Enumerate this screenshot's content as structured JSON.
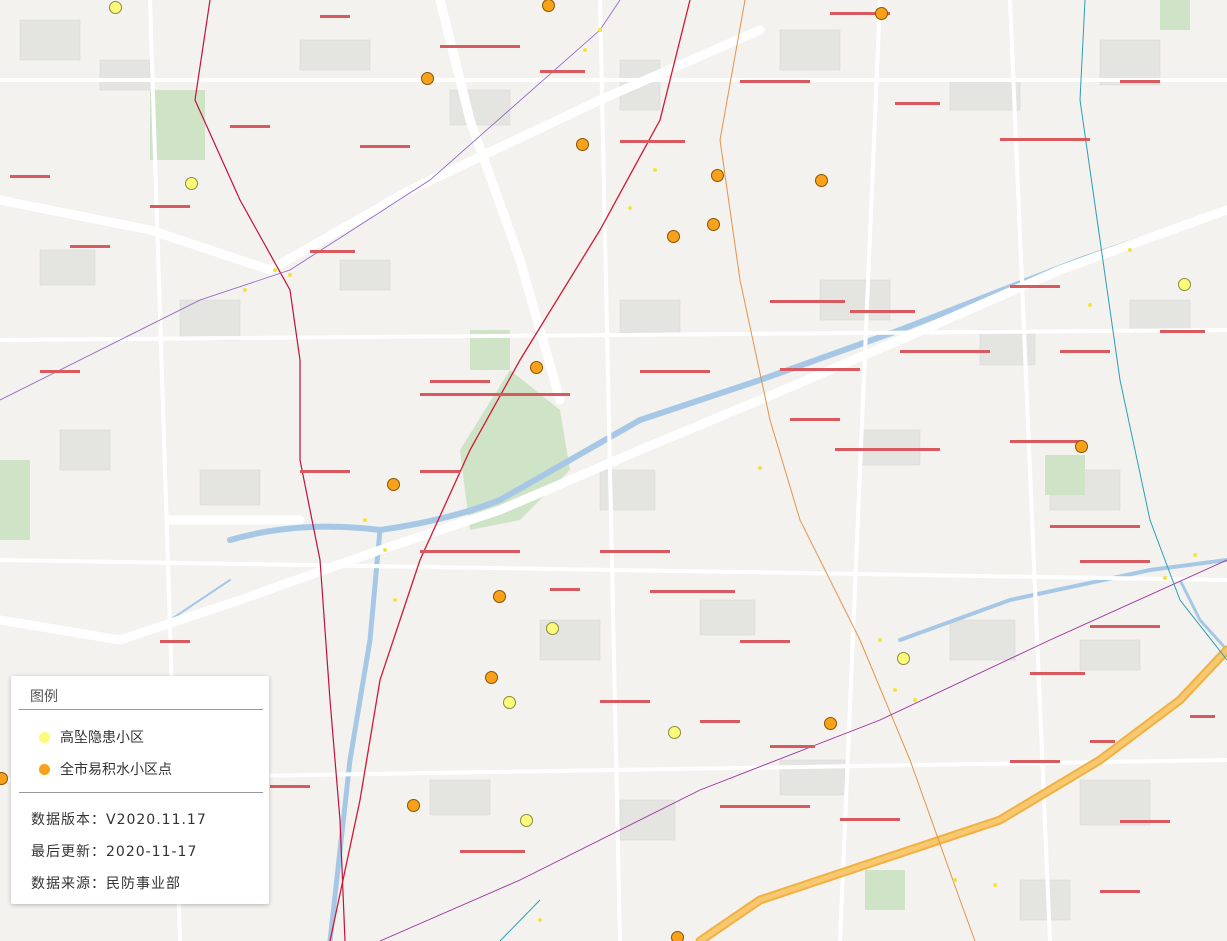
{
  "legend": {
    "title": "图例",
    "items": [
      {
        "label": "高坠隐患小区",
        "color": "#fbfb7a"
      },
      {
        "label": "全市易积水小区点",
        "color": "#f7a21a"
      }
    ],
    "version_label": "数据版本：",
    "version_value": "V2020.11.17",
    "updated_label": "最后更新：",
    "updated_value": "2020-11-17",
    "source_label": "数据来源：",
    "source_value": "民防事业部"
  },
  "colors": {
    "high_fall_risk": "#fbfb7a",
    "waterlogging": "#f7a21a"
  }
}
